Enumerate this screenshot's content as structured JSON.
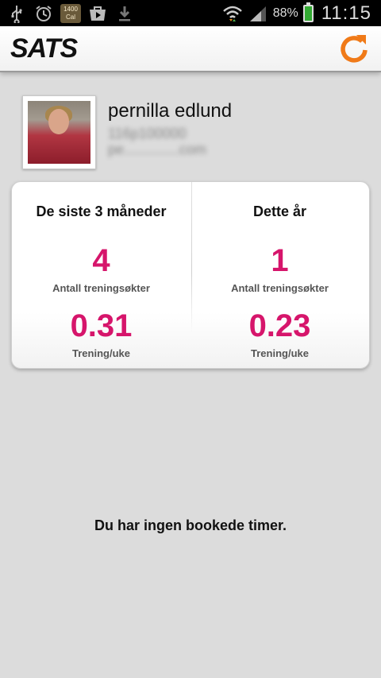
{
  "status_bar": {
    "icons": [
      "usb-icon",
      "alarm-icon",
      "calendar-icon",
      "play-store-icon",
      "download-icon",
      "wifi-icon",
      "signal-icon",
      "battery-icon"
    ],
    "calorie_badge": {
      "value": "1400",
      "unit": "Cal"
    },
    "battery_percent": "88%",
    "time": "11:15"
  },
  "app_bar": {
    "logo_text": "SATS",
    "refresh_icon": "refresh-icon",
    "accent_color": "#f07a18"
  },
  "profile": {
    "name": "pernilla edlund",
    "line1": "116p100000",
    "line2": "pe..............com"
  },
  "stats": {
    "left": {
      "title": "De siste 3 måneder",
      "sessions_value": "4",
      "sessions_label": "Antall treningsøkter",
      "per_week_value": "0.31",
      "per_week_label": "Trening/uke"
    },
    "right": {
      "title": "Dette år",
      "sessions_value": "1",
      "sessions_label": "Antall treningsøkter",
      "per_week_value": "0.23",
      "per_week_label": "Trening/uke"
    },
    "value_color": "#d6156b"
  },
  "bookings": {
    "empty_message": "Du har ingen bookede timer."
  }
}
